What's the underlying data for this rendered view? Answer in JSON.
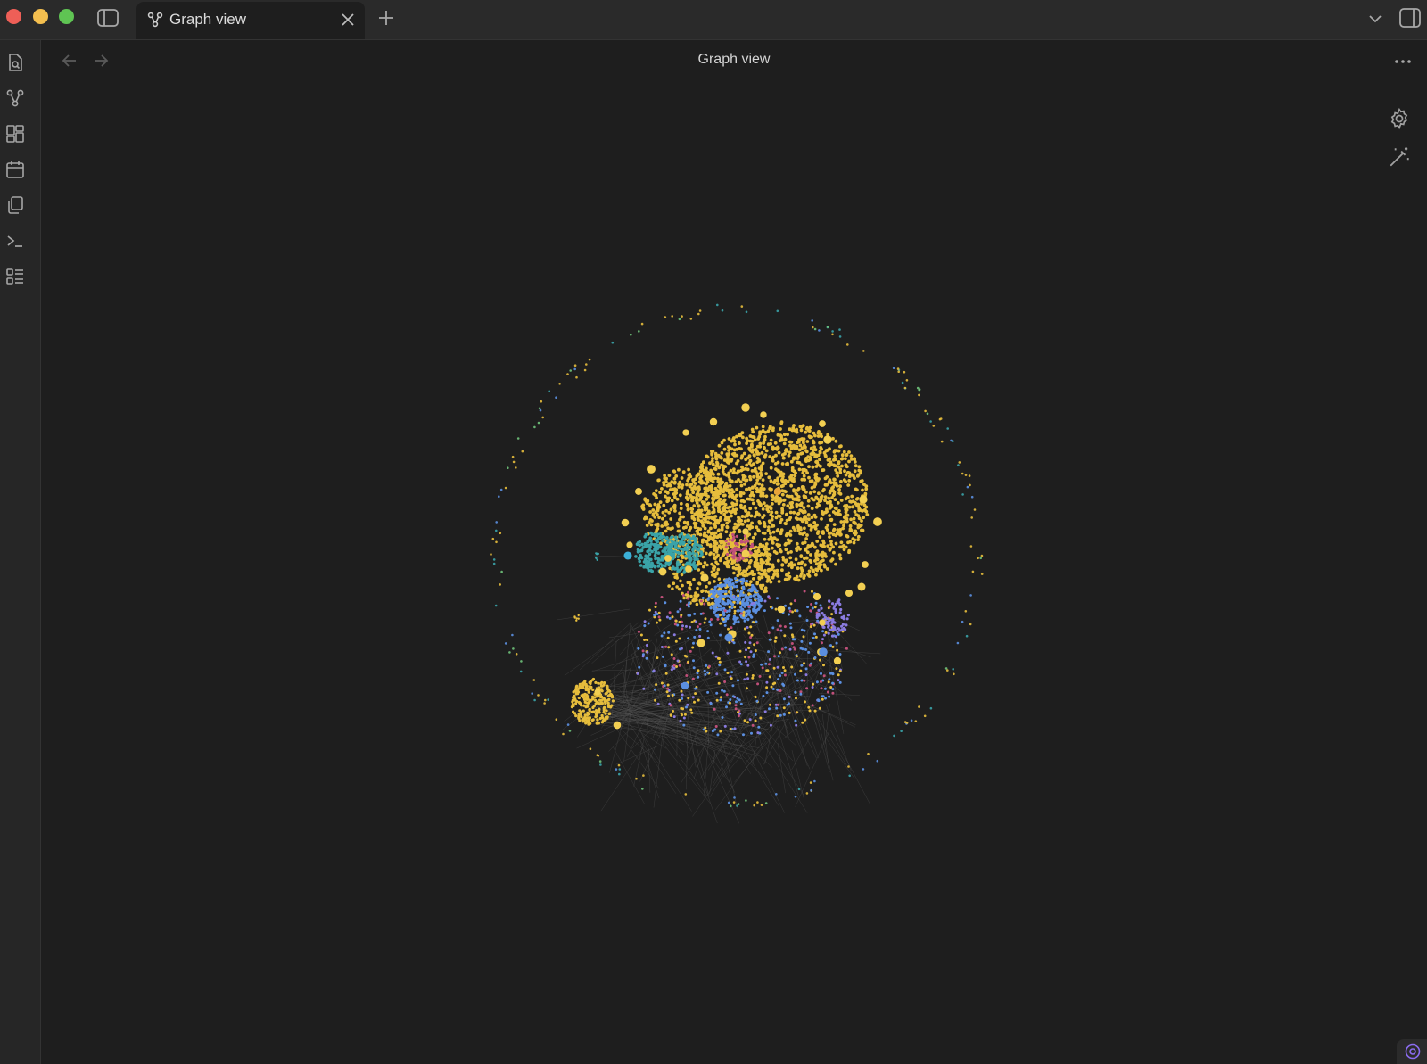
{
  "window": {
    "tab": {
      "label": "Graph view",
      "icon": "graph-icon"
    }
  },
  "header": {
    "title": "Graph view"
  },
  "ribbon": {
    "items": [
      {
        "name": "quick-switcher-icon"
      },
      {
        "name": "graph-icon"
      },
      {
        "name": "canvas-icon"
      },
      {
        "name": "calendar-icon"
      },
      {
        "name": "copy-icon"
      },
      {
        "name": "terminal-icon"
      },
      {
        "name": "list-icon"
      }
    ]
  },
  "graph_controls": [
    {
      "name": "settings-gear-icon"
    },
    {
      "name": "magic-wand-icon"
    }
  ],
  "colors": {
    "background": "#1e1e1e",
    "node_yellow": "#e6bd3c",
    "node_teal": "#3aa3a8",
    "node_blue": "#5b8fe0",
    "node_purple": "#8a7be0",
    "node_pink": "#c0507a",
    "edge": "#555555"
  }
}
